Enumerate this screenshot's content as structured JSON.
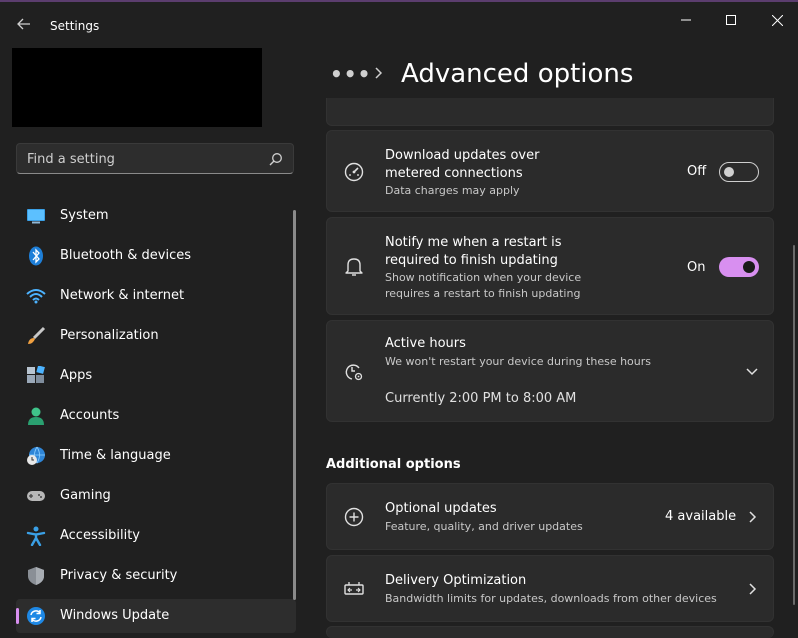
{
  "app": {
    "title": "Settings"
  },
  "window": {
    "minimize_icon": "minimize-icon",
    "maximize_icon": "maximize-icon",
    "close_icon": "close-icon"
  },
  "search": {
    "placeholder": "Find a setting"
  },
  "sidebar": {
    "items": [
      {
        "label": "System",
        "icon": "system-icon"
      },
      {
        "label": "Bluetooth & devices",
        "icon": "bluetooth-icon"
      },
      {
        "label": "Network & internet",
        "icon": "wifi-icon"
      },
      {
        "label": "Personalization",
        "icon": "brush-icon"
      },
      {
        "label": "Apps",
        "icon": "apps-icon"
      },
      {
        "label": "Accounts",
        "icon": "person-icon"
      },
      {
        "label": "Time & language",
        "icon": "globe-clock-icon"
      },
      {
        "label": "Gaming",
        "icon": "gamepad-icon"
      },
      {
        "label": "Accessibility",
        "icon": "accessibility-icon"
      },
      {
        "label": "Privacy & security",
        "icon": "shield-icon"
      },
      {
        "label": "Windows Update",
        "icon": "windows-update-icon",
        "active": true
      }
    ]
  },
  "breadcrumb": {
    "more": "•••",
    "title": "Advanced options"
  },
  "cards": {
    "metered": {
      "title_line1": "Download updates over",
      "title_line2": "metered connections",
      "subtitle": "Data charges may apply",
      "state_label": "Off",
      "state": false
    },
    "restart_notify": {
      "title_line1": "Notify me when a restart is",
      "title_line2": "required to finish updating",
      "subtitle_line1": "Show notification when your device",
      "subtitle_line2": "requires a restart to finish updating",
      "state_label": "On",
      "state": true
    },
    "active_hours": {
      "title": "Active hours",
      "subtitle": "We won't restart your device during these hours",
      "current": "Currently 2:00 PM to 8:00 AM"
    }
  },
  "additional": {
    "section_title": "Additional options",
    "optional_updates": {
      "title": "Optional updates",
      "subtitle": "Feature, quality, and driver updates",
      "count": "4 available"
    },
    "delivery_optimization": {
      "title": "Delivery Optimization",
      "subtitle": "Bandwidth limits for updates, downloads from other devices"
    }
  },
  "colors": {
    "accent": "#d88ff0",
    "background": "#202020",
    "card": "#2b2b2b"
  }
}
